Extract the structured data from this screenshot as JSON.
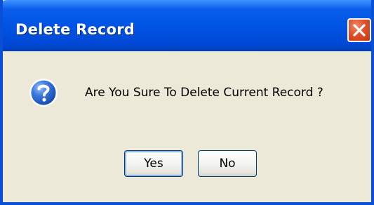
{
  "dialog": {
    "title": "Delete Record",
    "close_icon": "close-icon",
    "message_icon": "question-icon",
    "message": "Are You Sure To Delete Current Record ?",
    "buttons": {
      "yes_label": "Yes",
      "no_label": "No"
    }
  },
  "colors": {
    "titlebar": "#0054e3",
    "body": "#ece9d8",
    "close_button": "#e0502a",
    "question_icon": "#2a6fd6"
  }
}
